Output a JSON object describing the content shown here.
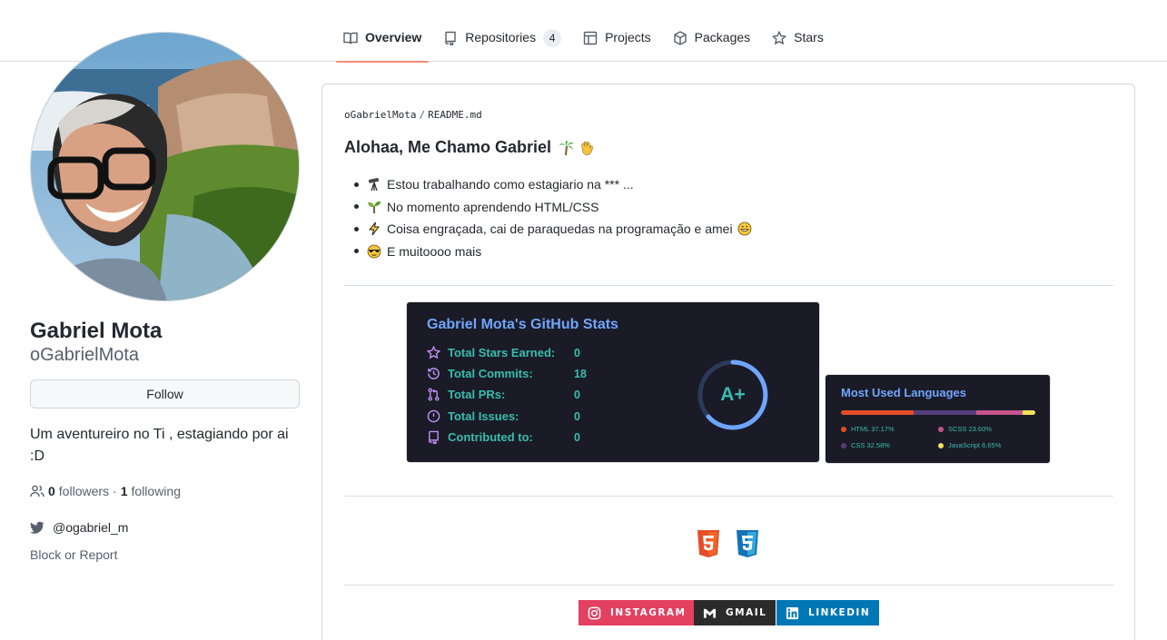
{
  "tabs": [
    {
      "label": "Overview",
      "icon": "book-icon",
      "active": true
    },
    {
      "label": "Repositories",
      "icon": "repo-icon",
      "count": "4"
    },
    {
      "label": "Projects",
      "icon": "table-icon"
    },
    {
      "label": "Packages",
      "icon": "package-icon"
    },
    {
      "label": "Stars",
      "icon": "star-icon"
    }
  ],
  "profile": {
    "fullname": "Gabriel Mota",
    "username": "oGabrielMota",
    "follow_label": "Follow",
    "bio": "Um aventureiro no Ti , estagiando por ai :D",
    "followers_count": "0",
    "followers_label": "followers",
    "separator": "·",
    "following_count": "1",
    "following_label": "following",
    "twitter": "@ogabriel_m",
    "block_label": "Block or Report"
  },
  "readme": {
    "path_user": "oGabrielMota",
    "path_sep": "/",
    "path_file": "README.md",
    "heading": "Alohaa, Me Chamo Gabriel",
    "items": [
      {
        "text": "Estou trabalhando como estagiario na *** ...",
        "icon": "telescope-icon"
      },
      {
        "text": "No momento aprendendo HTML/CSS",
        "icon": "seedling-icon"
      },
      {
        "text": "Coisa engraçada, cai de paraquedas na programação e amei",
        "icon": "lightning-icon"
      },
      {
        "text": "E muitoooo mais",
        "icon": "sunglasses-icon"
      }
    ]
  },
  "stats": {
    "title": "Gabriel Mota's GitHub Stats",
    "rows": [
      {
        "label": "Total Stars Earned:",
        "value": "0"
      },
      {
        "label": "Total Commits:",
        "value": "18"
      },
      {
        "label": "Total PRs:",
        "value": "0"
      },
      {
        "label": "Total Issues:",
        "value": "0"
      },
      {
        "label": "Contributed to:",
        "value": "0"
      }
    ],
    "grade": "A+",
    "colors": {
      "bg": "#1a1b27",
      "title": "#70a5fd",
      "text": "#38bdae",
      "icon": "#bf91f3"
    }
  },
  "languages": {
    "title": "Most Used Languages",
    "items": [
      {
        "name": "HTML",
        "percent": 37.17,
        "label": "HTML 37.17%",
        "color": "#e34c26"
      },
      {
        "name": "CSS",
        "percent": 32.58,
        "label": "CSS 32.58%",
        "color": "#563d7c"
      },
      {
        "name": "SCSS",
        "percent": 23.6,
        "label": "SCSS 23.60%",
        "color": "#c6538c"
      },
      {
        "name": "JavaScript",
        "percent": 6.65,
        "label": "JavaScript 6.65%",
        "color": "#f1e05a"
      }
    ]
  },
  "tech_icons": [
    "html5-icon",
    "css3-icon"
  ],
  "socials": [
    {
      "label": "INSTAGRAM",
      "icon": "instagram-icon",
      "color": "#e4405f"
    },
    {
      "label": "GMAIL",
      "icon": "gmail-icon",
      "color": "#2b2b2b"
    },
    {
      "label": "LINKEDIN",
      "icon": "linkedin-icon",
      "color": "#0077b5"
    }
  ]
}
